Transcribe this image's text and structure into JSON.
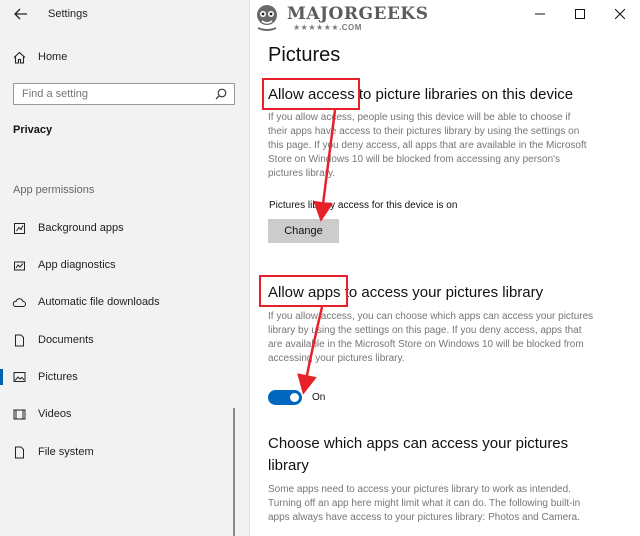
{
  "window": {
    "title": "Settings"
  },
  "sidebar": {
    "home_label": "Home",
    "search_placeholder": "Find a setting",
    "section": "Privacy",
    "group_label": "App permissions",
    "items": [
      {
        "label": "Background apps",
        "icon": "background-apps-icon"
      },
      {
        "label": "App diagnostics",
        "icon": "app-diagnostics-icon"
      },
      {
        "label": "Automatic file downloads",
        "icon": "cloud-icon"
      },
      {
        "label": "Documents",
        "icon": "document-icon"
      },
      {
        "label": "Pictures",
        "icon": "pictures-icon",
        "active": true
      },
      {
        "label": "Videos",
        "icon": "videos-icon"
      },
      {
        "label": "File system",
        "icon": "file-system-icon"
      }
    ]
  },
  "watermark": {
    "name": "MAJORGEEKS",
    "sub": "★★★★★★.COM"
  },
  "main": {
    "title": "Pictures",
    "section1": {
      "heading": "Allow access to picture libraries on this device",
      "body": [
        "If you allow access, people using this device will be able to choose if",
        "their apps have access to their pictures library by using the settings on",
        "this page. If you deny access, all apps that are available in the Microsoft",
        "Store on Windows 10 will be blocked from accessing any person's",
        "pictures library."
      ],
      "status": "Pictures library access for this device is on",
      "button": "Change"
    },
    "section2": {
      "heading": "Allow apps to access your pictures library",
      "body": [
        "If you allow access, you can choose which apps can access your pictures",
        "library by using the settings on this page. If you deny access, apps that",
        "are available in the Microsoft Store on Windows 10 will be blocked from",
        "accessing your pictures library."
      ],
      "toggle_state": "On"
    },
    "section3": {
      "heading_line1": "Choose which apps can access your pictures",
      "heading_line2": "library",
      "body": [
        "Some apps need to access your pictures library to work as intended.",
        "Turning off an app here might limit what it can do. The following built-in",
        "apps always have access to your pictures library: Photos and Camera."
      ]
    }
  },
  "colors": {
    "accent": "#0067c0",
    "annotation": "#e8202a"
  }
}
